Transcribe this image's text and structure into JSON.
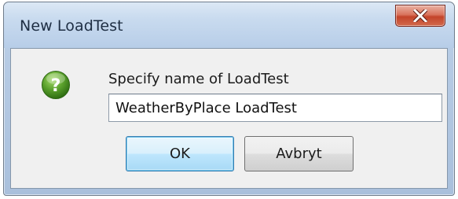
{
  "window": {
    "title": "New LoadTest",
    "close_icon": "close-icon",
    "close_color": "#c3442a"
  },
  "dialog": {
    "icon": "question-mark-icon",
    "icon_color": "#5aa02c",
    "prompt": "Specify name of LoadTest",
    "input_value": "WeatherByPlace LoadTest"
  },
  "buttons": {
    "ok_label": "OK",
    "cancel_label": "Avbryt"
  }
}
